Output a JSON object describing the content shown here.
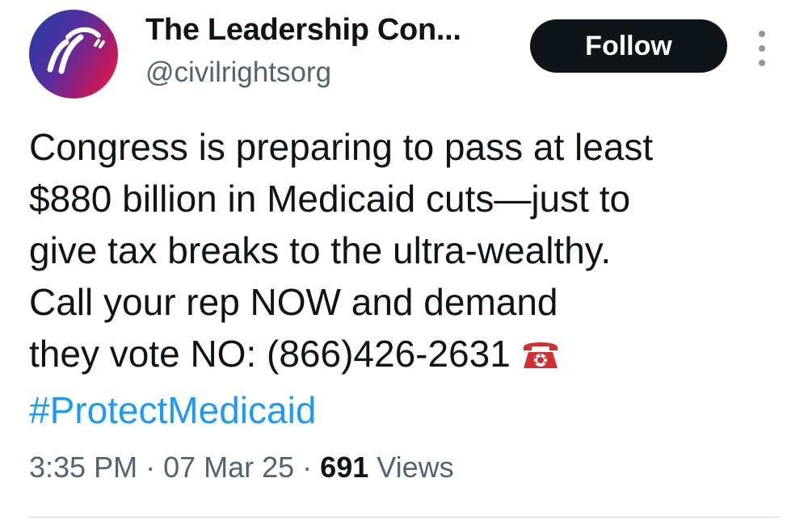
{
  "author": {
    "display_name": "The Leadership Con...",
    "handle": "@civilrightsorg",
    "avatar_icon": "leadership-conference-logo-icon",
    "avatar_colors": [
      "#1f3fa6",
      "#5a2d9c",
      "#c2185b",
      "#e53935"
    ]
  },
  "actions": {
    "follow_label": "Follow",
    "more_icon": "more-vertical-icon"
  },
  "tweet": {
    "lines": [
      "Congress is preparing to pass at least",
      "$880 billion in Medicaid cuts—just to",
      "give tax breaks to the ultra-wealthy.",
      "Call your rep NOW and demand",
      "they vote NO: (866)426-2631"
    ],
    "emoji_icon": "telephone-icon",
    "hashtag": "#ProtectMedicaid"
  },
  "meta": {
    "time": "3:35 PM",
    "date": "07 Mar 25",
    "views_count": "691",
    "views_label": "Views",
    "separator": "·"
  },
  "colors": {
    "text": "#0f1419",
    "secondary": "#536471",
    "link": "#1d9bf0",
    "button_bg": "#0f1419"
  }
}
